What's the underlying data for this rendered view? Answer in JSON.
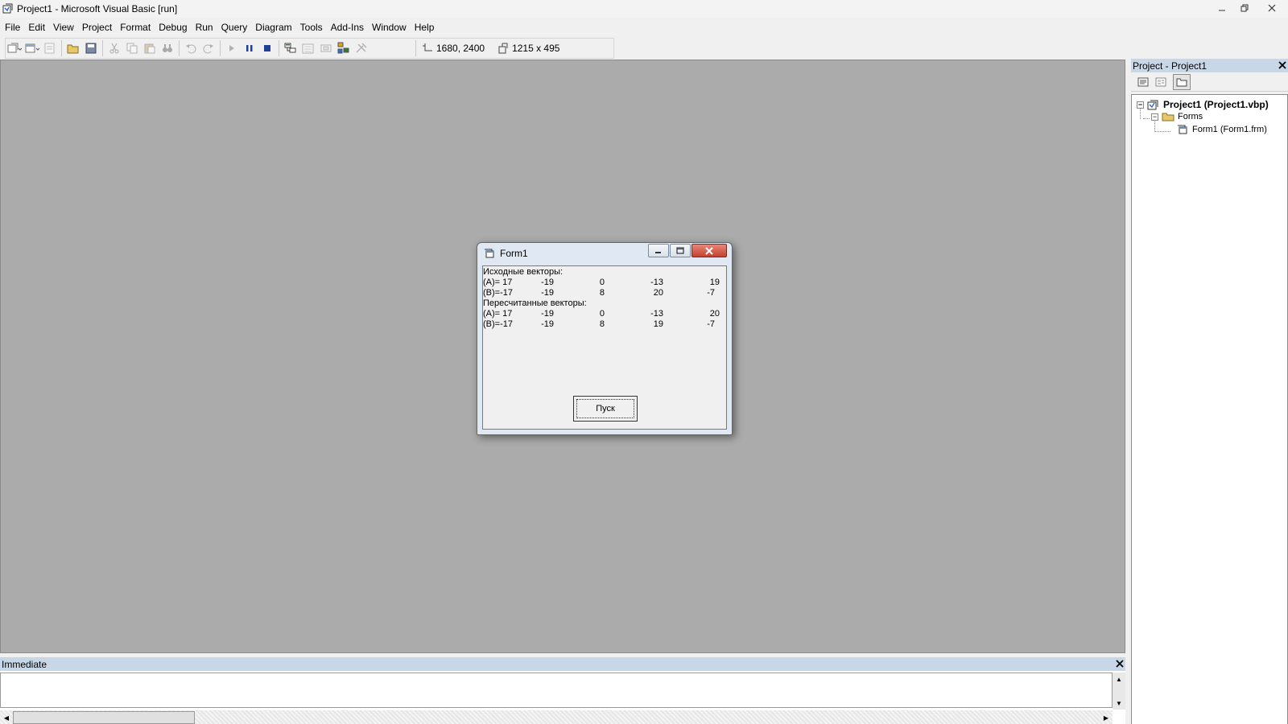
{
  "window": {
    "title": "Project1 - Microsoft Visual Basic [run]"
  },
  "menu": [
    "File",
    "Edit",
    "View",
    "Project",
    "Format",
    "Debug",
    "Run",
    "Query",
    "Diagram",
    "Tools",
    "Add-Ins",
    "Window",
    "Help"
  ],
  "toolbar": {
    "position": "1680, 2400",
    "size": "1215 x 495"
  },
  "form1": {
    "title": "Form1",
    "output_lines": {
      "original_heading": "Исходные векторы:",
      "recalc_heading": "Пересчитанные векторы:"
    },
    "rows": [
      {
        "label": "(A)= 17",
        "values": [
          "-19",
          "0",
          "-13",
          "19"
        ]
      },
      {
        "label": "(B)=-17",
        "values": [
          "-19",
          "8",
          "20",
          "-7"
        ]
      },
      {
        "label": "(A)= 17",
        "values": [
          "-19",
          "0",
          "-13",
          "20"
        ]
      },
      {
        "label": "(B)=-17",
        "values": [
          "-19",
          "8",
          "19",
          "-7"
        ]
      }
    ],
    "run_button": "Пуск"
  },
  "project_explorer": {
    "title": "Project - Project1",
    "root": "Project1 (Project1.vbp)",
    "folder": "Forms",
    "item": "Form1 (Form1.frm)"
  },
  "immediate": {
    "title": "Immediate"
  },
  "colors": {
    "workspace": "#ababab",
    "panel_header": "#c7d7e7",
    "stop_blue": "#1f3f99",
    "close_red": "#c3422f"
  }
}
